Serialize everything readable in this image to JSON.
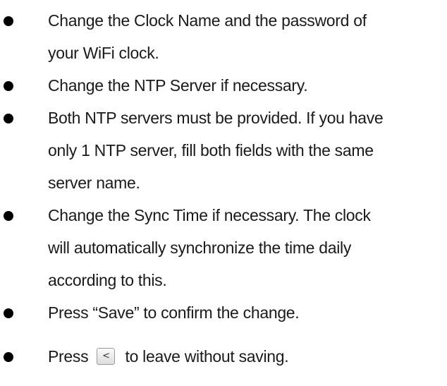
{
  "instructions": {
    "item1": {
      "line1": "Change the Clock Name and the password of",
      "line2": "your WiFi clock."
    },
    "item2": {
      "line1": "Change the NTP Server if necessary."
    },
    "item3": {
      "line1": "Both NTP servers must be provided. If you have",
      "line2": "only 1 NTP server, fill both fields with the same",
      "line3": "server name."
    },
    "item4": {
      "line1": "Change the Sync Time if necessary. The clock",
      "line2": "will automatically synchronize the time daily",
      "line3": "according to this."
    },
    "item5": {
      "line1": "Press “Save” to confirm the change."
    },
    "item6": {
      "before": "Press",
      "button_glyph": "<",
      "after": "to leave without saving."
    }
  },
  "bullet_icon": "black-circle-bullet",
  "button_icon": "back-chevron-button"
}
